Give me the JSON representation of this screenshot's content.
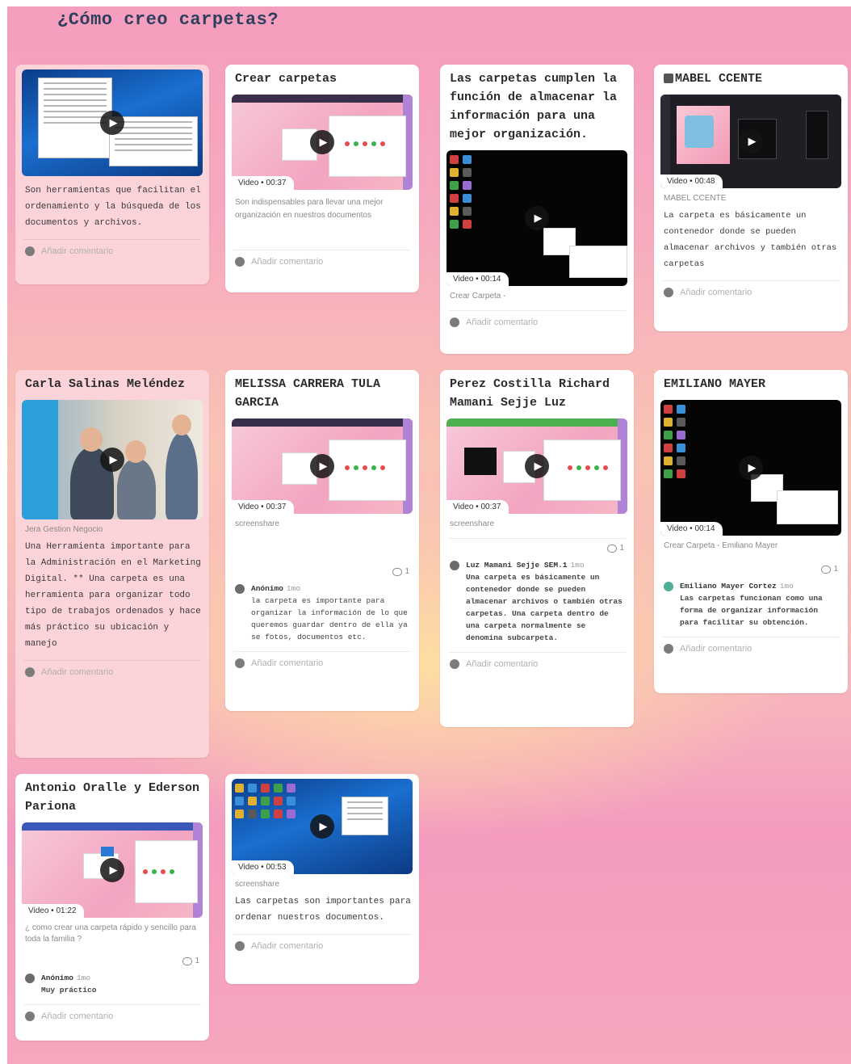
{
  "board": {
    "title": "¿Cómo creo carpetas?"
  },
  "cards": {
    "c1": {
      "text": "Son herramientas que facilitan el ordenamiento y la búsqueda de los documentos y archivos.",
      "add_comment": "Añadir comentario"
    },
    "c2": {
      "title": "Crear carpetas",
      "badge": "Video • 00:37",
      "text": "Son indispensables para llevar una mejor organización en nuestros documentos",
      "add_comment": "Añadir comentario"
    },
    "c3": {
      "title": "Las carpetas cumplen la función de almacenar la información para una mejor organización.",
      "badge": "Video • 00:14",
      "meta": "Crear Carpeta -",
      "add_comment": "Añadir comentario"
    },
    "c4": {
      "title": "MABEL CCENTE",
      "badge": "Video • 00:48",
      "meta": "MABEL CCENTE",
      "text": "La carpeta es básicamente un contenedor donde se pueden almacenar archivos y también otras carpetas",
      "add_comment": "Añadir comentario"
    },
    "c5": {
      "title": "Carla Salinas Meléndez",
      "meta": "Jera Gestion Negocio",
      "text": "Una Herramienta importante para la Administración en el Marketing Digital. ** Una carpeta es una herramienta para organizar todo tipo de trabajos ordenados y hace más práctico su ubicación y manejo",
      "add_comment": "Añadir comentario"
    },
    "c6": {
      "title": "MELISSA CARRERA TULA GARCIA",
      "badge": "Video • 00:37",
      "meta": "screenshare",
      "count": "1",
      "comment_name": "Anónimo",
      "comment_tag": "1mo",
      "comment_text": "la carpeta es importante para organizar la información de lo que queremos guardar dentro de ella ya se fotos, documentos etc.",
      "add_comment": "Añadir comentario"
    },
    "c7": {
      "title": "Perez Costilla Richard Mamani Sejje Luz",
      "badge": "Video • 00:37",
      "meta": "screenshare",
      "count": "1",
      "comment_name": "Luz Mamani Sejje SEM.1",
      "comment_tag": "1mo",
      "comment_text": "Una carpeta es básicamente un contenedor donde se pueden almacenar archivos o también otras carpetas. Una carpeta dentro de una carpeta normalmente se denomina subcarpeta.",
      "add_comment": "Añadir comentario"
    },
    "c8": {
      "title": "EMILIANO MAYER",
      "badge": "Video • 00:14",
      "meta": "Crear Carpeta - Emiliano Mayer",
      "count": "1",
      "comment_name": "Emiliano Mayer Cortez",
      "comment_tag": "1mo",
      "comment_text": "Las carpetas funcionan como una forma de organizar información para facilitar su obtención.",
      "add_comment": "Añadir comentario"
    },
    "c9": {
      "title": "Antonio Oralle y Ederson Pariona",
      "badge": "Video • 01:22",
      "meta": "¿ como crear una carpeta rápido y sencillo para toda la familia ?",
      "count": "1",
      "comment_name": "Anónimo",
      "comment_tag": "1mo",
      "comment_text": "Muy práctico",
      "add_comment": "Añadir comentario"
    },
    "c10": {
      "badge": "Video • 00:53",
      "meta": "screenshare",
      "text": "Las carpetas son importantes para ordenar nuestros documentos.",
      "add_comment": "Añadir comentario"
    }
  },
  "icons": {
    "play": "play-icon",
    "comment": "comment-bubble-icon",
    "avatar": "avatar-icon"
  },
  "colors": {
    "board_top": "#f59dbd",
    "board_mid": "#f9c4b4",
    "card_pink": "#fbd3d8",
    "card_white": "#ffffff",
    "title_text": "#2e3f5e"
  }
}
